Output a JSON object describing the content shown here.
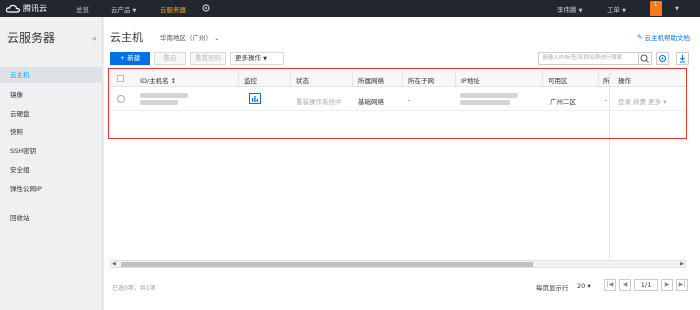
{
  "topnav": {
    "brand": "腾讯云",
    "items": [
      "总览",
      "云产品",
      "云服务器"
    ],
    "user": "李伟鹏",
    "ticket": "工单",
    "mail_count": "1"
  },
  "sidebar": {
    "title": "云服务器",
    "items": [
      "云主机",
      "镜像",
      "云硬盘",
      "快照",
      "SSH密钥",
      "安全组",
      "弹性公网IP",
      "回收站"
    ]
  },
  "header": {
    "title": "云主机",
    "region": "华南地区（广州）",
    "help": "云主机帮助文档"
  },
  "toolbar": {
    "new": "+ 新建",
    "restart": "重启",
    "reset_pwd": "重置密码",
    "more": "更多操作",
    "search_placeholder": "请输入IP/标签/实例名称进行搜索"
  },
  "table": {
    "columns": [
      "ID/主机名 ↕",
      "监控",
      "状态",
      "所属网络",
      "所在子网",
      "IP地址",
      "可用区",
      "所",
      "操作"
    ],
    "row": {
      "status": "重装操作系统中",
      "network": "基础网络",
      "subnet": "-",
      "zone": "广州二区",
      "col8": "-",
      "actions": "登录 续费 更多 ▾"
    }
  },
  "footer": {
    "summary": "已选0项，共1项",
    "per_page_label": "每页显示行",
    "per_page": "20 ▾",
    "page": "1/1"
  },
  "colors": {
    "accent": "#0071e3",
    "nav_bg": "#22262e",
    "active_nav": "#f5a623",
    "highlight": "#ee3333"
  }
}
